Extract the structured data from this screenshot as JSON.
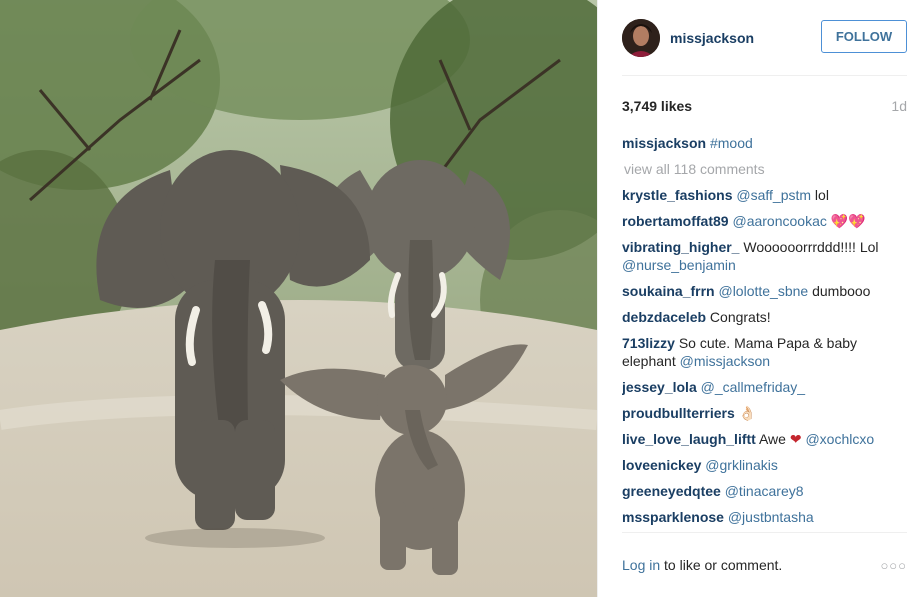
{
  "post": {
    "username": "missjackson",
    "follow_label": "FOLLOW",
    "likes": "3,749 likes",
    "age": "1d",
    "caption": {
      "user": "missjackson",
      "text": "#mood"
    },
    "view_all": "view all 118 comments",
    "comments": [
      {
        "user": "krystle_fashions",
        "mention": "@saff_pstm",
        "text": " lol"
      },
      {
        "user": "robertamoffat89",
        "mention": "@aaroncookac",
        "text": " 💖💖"
      },
      {
        "user": "vibrating_higher_",
        "text": " Woooooorrrddd!!!! Lol ",
        "mention": "@nurse_benjamin"
      },
      {
        "user": "soukaina_frrn",
        "mention": "@lolotte_sbne",
        "text": " dumbooo"
      },
      {
        "user": "debzdaceleb",
        "text": " Congrats!"
      },
      {
        "user": "713lizzy",
        "text": " So cute. Mama Papa & baby elephant ",
        "mention": "@missjackson"
      },
      {
        "user": "jessey_lola",
        "mention": "@_callmefriday_"
      },
      {
        "user": "proudbullterriers",
        "text": " 👌🏻"
      },
      {
        "user": "live_love_laugh_liftt",
        "text": " Awe ",
        "heart": "❤",
        "mention": "@xochlcxo"
      },
      {
        "user": "loveenickey",
        "mention": "@grklinakis"
      },
      {
        "user": "greeneyedqtee",
        "mention": "@tinacarey8"
      },
      {
        "user": "mssparklenose",
        "mention": "@justbntasha"
      }
    ],
    "login_link": "Log in",
    "login_text": " to like or comment.",
    "more_icon": "○○○"
  }
}
